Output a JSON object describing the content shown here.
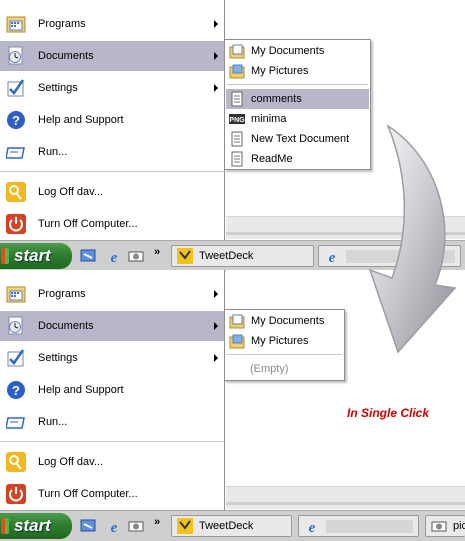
{
  "colors": {
    "highlight": "#b8b7c9",
    "caption": "#d60000",
    "start_green": "#2f7e2f"
  },
  "panel_top": {
    "menu_items": [
      {
        "label": "Programs",
        "icon": "programs-icon",
        "submenu": true
      },
      {
        "label": "Documents",
        "icon": "documents-icon",
        "submenu": true,
        "selected": true
      },
      {
        "label": "Settings",
        "icon": "settings-icon",
        "submenu": true
      },
      {
        "label": "Help and Support",
        "icon": "help-icon",
        "submenu": false
      },
      {
        "label": "Run...",
        "icon": "run-icon",
        "submenu": false
      },
      {
        "label": "Log Off dav...",
        "icon": "logoff-icon",
        "submenu": false
      },
      {
        "label": "Turn Off Computer...",
        "icon": "power-icon",
        "submenu": false
      }
    ],
    "documents_submenu": [
      {
        "label": "My Documents",
        "icon": "folder-icon"
      },
      {
        "label": "My Pictures",
        "icon": "folder-icon"
      },
      {
        "label": "comments",
        "icon": "text-file-icon",
        "selected": true
      },
      {
        "label": "minima",
        "icon": "png-file-icon"
      },
      {
        "label": "New Text Document",
        "icon": "text-file-icon"
      },
      {
        "label": "ReadMe",
        "icon": "text-file-icon"
      }
    ]
  },
  "panel_bottom": {
    "menu_items": [
      {
        "label": "Programs",
        "icon": "programs-icon",
        "submenu": true
      },
      {
        "label": "Documents",
        "icon": "documents-icon",
        "submenu": true,
        "selected": true
      },
      {
        "label": "Settings",
        "icon": "settings-icon",
        "submenu": true
      },
      {
        "label": "Help and Support",
        "icon": "help-icon",
        "submenu": false
      },
      {
        "label": "Run...",
        "icon": "run-icon",
        "submenu": false
      },
      {
        "label": "Log Off dav...",
        "icon": "logoff-icon",
        "submenu": false
      },
      {
        "label": "Turn Off Computer...",
        "icon": "power-icon",
        "submenu": false
      }
    ],
    "documents_submenu": [
      {
        "label": "My Documents",
        "icon": "folder-icon"
      },
      {
        "label": "My Pictures",
        "icon": "folder-icon"
      }
    ],
    "empty_label": "(Empty)"
  },
  "taskbar": {
    "start_label": "start",
    "quick_launch": [
      "desktop-icon",
      "ie-icon",
      "camera-icon"
    ],
    "chevron": "»",
    "tweetdeck_label": "TweetDeck",
    "partial_label": "pic"
  },
  "caption": "In Single Click"
}
